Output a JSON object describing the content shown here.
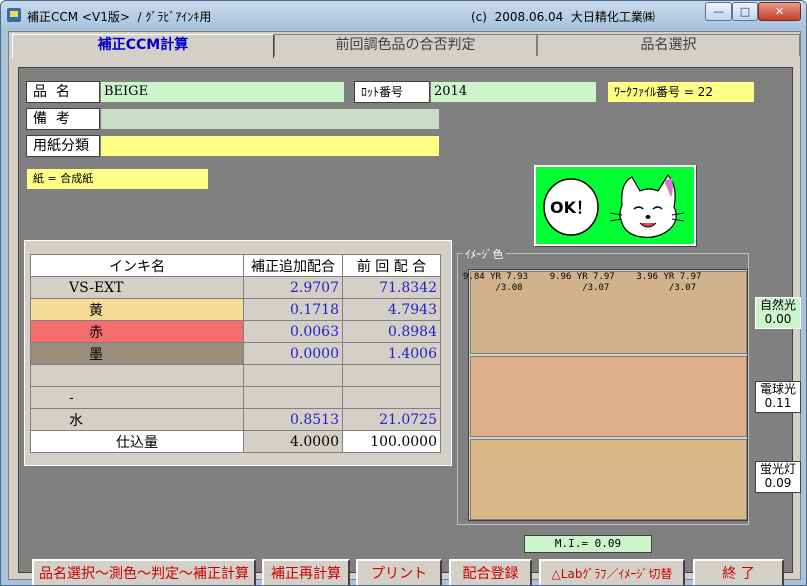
{
  "window": {
    "title": "補正CCM <V1版>  / ｸﾞﾗﾋﾞｱｲﾝｷ用",
    "subtitle": "(c)  2008.06.04  大日精化工業㈱",
    "min_glyph": "—",
    "max_glyph": "□",
    "close_glyph": "✕"
  },
  "tabs": [
    {
      "label": "補正CCM計算",
      "active": true
    },
    {
      "label": "前回調色品の合否判定",
      "active": false
    },
    {
      "label": "品名選択",
      "active": false
    }
  ],
  "fields": {
    "product_label": "品  名",
    "product_value": "BEIGE",
    "lot_label": "ﾛｯﾄ番号",
    "lot_value": "2014",
    "workfile_badge": "ﾜｰｸﾌｧｲﾙ番号 = 22",
    "remarks_label": "備  考",
    "remarks_value": "",
    "paper_label": "用紙分類",
    "paper_value": "",
    "paper_badge": "紙 = 合成紙"
  },
  "ok_image": {
    "text": "OK！",
    "colors": {
      "background": "#00ff33"
    }
  },
  "ink_table": {
    "headers": [
      "インキ名",
      "補正追加配合",
      "前 回 配 合"
    ],
    "rows": [
      {
        "name": "VS-EXT",
        "add": "2.9707",
        "prev": "71.8342",
        "bg": "#d4d0c8",
        "indent": false
      },
      {
        "name": "黄",
        "add": "0.1718",
        "prev": "4.7943",
        "bg": "#f5dc96",
        "indent": true
      },
      {
        "name": "赤",
        "add": "0.0063",
        "prev": "0.8984",
        "bg": "#f56e6e",
        "indent": true
      },
      {
        "name": "墨",
        "add": "0.0000",
        "prev": "1.4006",
        "bg": "#9a8c7a",
        "indent": true
      },
      {
        "name": "",
        "add": "",
        "prev": "",
        "bg": "#d4d0c8",
        "indent": false
      },
      {
        "name": "-",
        "add": "",
        "prev": "",
        "bg": "#d4d0c8",
        "indent": false
      },
      {
        "name": "水",
        "add": "0.8513",
        "prev": "21.0725",
        "bg": "#d4d0c8",
        "indent": false
      }
    ],
    "total": {
      "name": "仕込量",
      "add": "4.0000",
      "prev": "100.0000"
    }
  },
  "image_color": {
    "title": "ｲﾒｰｼﾞ色",
    "lab_line1": "9.84 YR 7.93    9.96 YR 7.97    3.96 YR 7.97",
    "lab_line2": "      /3.08           /3.07           /3.07",
    "swatches": [
      "#d2b28c",
      "#deaf88",
      "#dcb788"
    ]
  },
  "lights": [
    {
      "label": "自然光",
      "value": "0.00",
      "active": true
    },
    {
      "label": "電球光",
      "value": "0.11",
      "active": false
    },
    {
      "label": "蛍光灯",
      "value": "0.09",
      "active": false
    }
  ],
  "mi": "M.I.= 0.09",
  "buttons": {
    "calc": "品名選択～測色～判定～補正計算",
    "recalc": "補正再計算",
    "print": "プリント",
    "register": "配合登録",
    "graph": "△Labｸﾞﾗﾌ／ｲﾒｰｼﾞ切替",
    "exit": "終  了"
  }
}
